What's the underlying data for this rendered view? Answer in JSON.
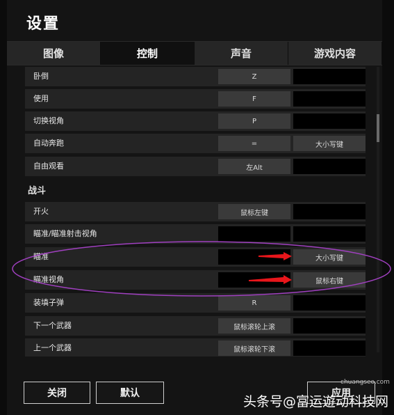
{
  "window": {
    "title": "设置"
  },
  "tabs": [
    {
      "label": "图像",
      "active": false
    },
    {
      "label": "控制",
      "active": true
    },
    {
      "label": "声音",
      "active": false
    },
    {
      "label": "游戏内容",
      "active": false
    }
  ],
  "rows_top": [
    {
      "action": "卧倒",
      "key1": "Z",
      "key2": ""
    },
    {
      "action": "使用",
      "key1": "F",
      "key2": ""
    },
    {
      "action": "切换视角",
      "key1": "P",
      "key2": ""
    },
    {
      "action": "自动奔跑",
      "key1": "=",
      "key2": "大小写键"
    },
    {
      "action": "自由观看",
      "key1": "左Alt",
      "key2": ""
    }
  ],
  "section_combat": "战斗",
  "rows_combat": [
    {
      "action": "开火",
      "key1": "鼠标左键",
      "key2": ""
    },
    {
      "action": "瞄准/瞄准射击视角",
      "key1": "",
      "key2": ""
    },
    {
      "action": "瞄准",
      "key1": "",
      "key2": "大小写键"
    },
    {
      "action": "瞄准视角",
      "key1": "",
      "key2": "鼠标右键"
    },
    {
      "action": "装填子弹",
      "key1": "R",
      "key2": ""
    },
    {
      "action": "下一个武器",
      "key1": "鼠标滚轮上滚",
      "key2": ""
    },
    {
      "action": "上一个武器",
      "key1": "鼠标滚轮下滚",
      "key2": ""
    }
  ],
  "footer": {
    "close_label": "关闭",
    "default_label": "默认",
    "apply_label": "应用"
  },
  "watermark": {
    "text": "头条号@富运遊动科技网",
    "site": "chuangseo.com"
  },
  "colors": {
    "annotation_ellipse": "#a040c0",
    "annotation_arrow": "#e8161b"
  }
}
